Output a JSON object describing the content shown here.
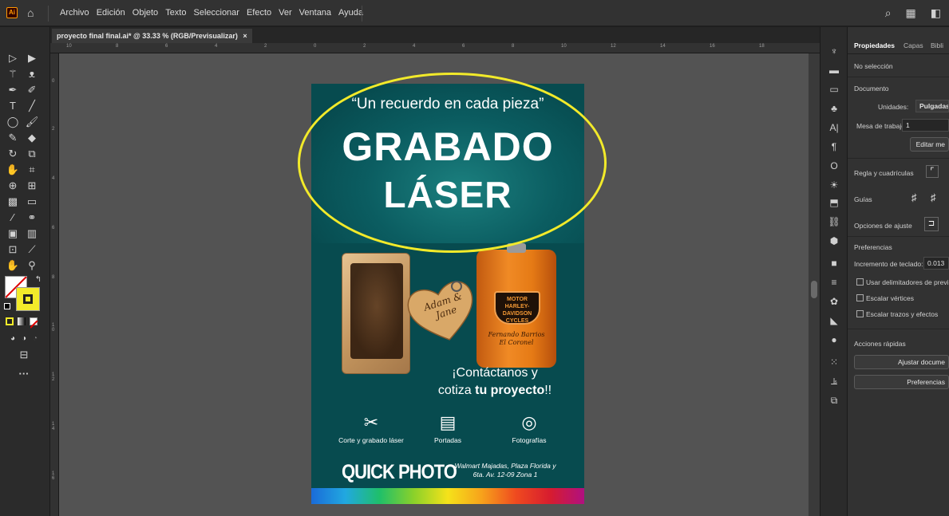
{
  "menubar": {
    "logo": "Ai",
    "items": [
      "Archivo",
      "Edición",
      "Objeto",
      "Texto",
      "Seleccionar",
      "Efecto",
      "Ver",
      "Ventana",
      "Ayuda"
    ]
  },
  "document": {
    "tab_title": "proyecto final final.ai* @ 33.33 % (RGB/Previsualizar)",
    "close_glyph": "×",
    "ruler_h": [
      "10",
      "8",
      "6",
      "4",
      "2",
      "0",
      "2",
      "4",
      "6",
      "8",
      "10",
      "12",
      "14",
      "16",
      "18"
    ],
    "ruler_v": [
      "0",
      "2",
      "4",
      "6",
      "8",
      "1 0",
      "1 2",
      "1 4",
      "1 6"
    ]
  },
  "poster": {
    "quote": "“Un recuerdo en cada pieza”",
    "title_line1": "GRABADO",
    "title_line2": "LÁSER",
    "heart_text": "Adam & Jane",
    "flask_logo": "MOTOR HARLEY-DAVIDSON CYCLES",
    "flask_engraving_1": "Fernando Barrios",
    "flask_engraving_2": "El Coronel",
    "cta_line1": "¡Contáctanos y",
    "cta_line2_a": "cotiza ",
    "cta_line2_b": "tu proyecto",
    "cta_line2_c": "!!",
    "services": [
      {
        "icon": "scissors-icon",
        "label": "Corte y grabado láser"
      },
      {
        "icon": "newspaper-icon",
        "label": "Portadas"
      },
      {
        "icon": "camera-icon",
        "label": "Fotografías"
      }
    ],
    "brand": "QUICK PHOTO",
    "address_line1": "Walmart Majadas, Plaza Florida y",
    "address_line2": "6ta. Av. 12-09 Zona 1"
  },
  "properties": {
    "tabs": [
      "Propiedades",
      "Capas",
      "Bibli"
    ],
    "no_selection": "No selección",
    "document_header": "Documento",
    "units_label": "Unidades:",
    "units_value": "Pulgadas",
    "artboard_label": "Mesa de trabajo:",
    "artboard_value": "1",
    "edit_button": "Editar me",
    "rulers_grids": "Regla y cuadrículas",
    "guides": "Guías",
    "snap_options": "Opciones de ajuste",
    "preferences_header": "Preferencias",
    "keyboard_increment_label": "Incremento de teclado:",
    "keyboard_increment_value": "0.013",
    "check_preview_bounds": "Usar delimitadores de previ",
    "check_scale_corners": "Escalar vértices",
    "check_scale_strokes": "Escalar trazos y efectos",
    "quick_actions_header": "Acciones rápidas",
    "fit_button": "Ajustar docume",
    "prefs_button": "Preferencias"
  },
  "colors": {
    "poster_bg": "#074b4f",
    "highlight_ellipse": "#f2ea2a",
    "fill_swatch": "#f2ea2a"
  }
}
